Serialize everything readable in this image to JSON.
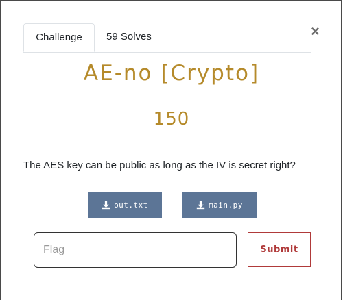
{
  "tabs": [
    {
      "label": "Challenge",
      "active": true
    },
    {
      "label": "59 Solves",
      "active": false
    }
  ],
  "close_label": "×",
  "challenge": {
    "title": "AE-no [Crypto]",
    "points": "150",
    "description": "The AES key can be public as long as the IV is secret right?"
  },
  "files": [
    {
      "name": "out.txt",
      "icon": "download-icon"
    },
    {
      "name": "main.py",
      "icon": "download-icon"
    }
  ],
  "flag_input": {
    "placeholder": "Flag",
    "value": ""
  },
  "submit_label": "Submit",
  "colors": {
    "accent": "#b58a2a",
    "file_button": "#5c7596",
    "submit": "#b03a3a"
  }
}
